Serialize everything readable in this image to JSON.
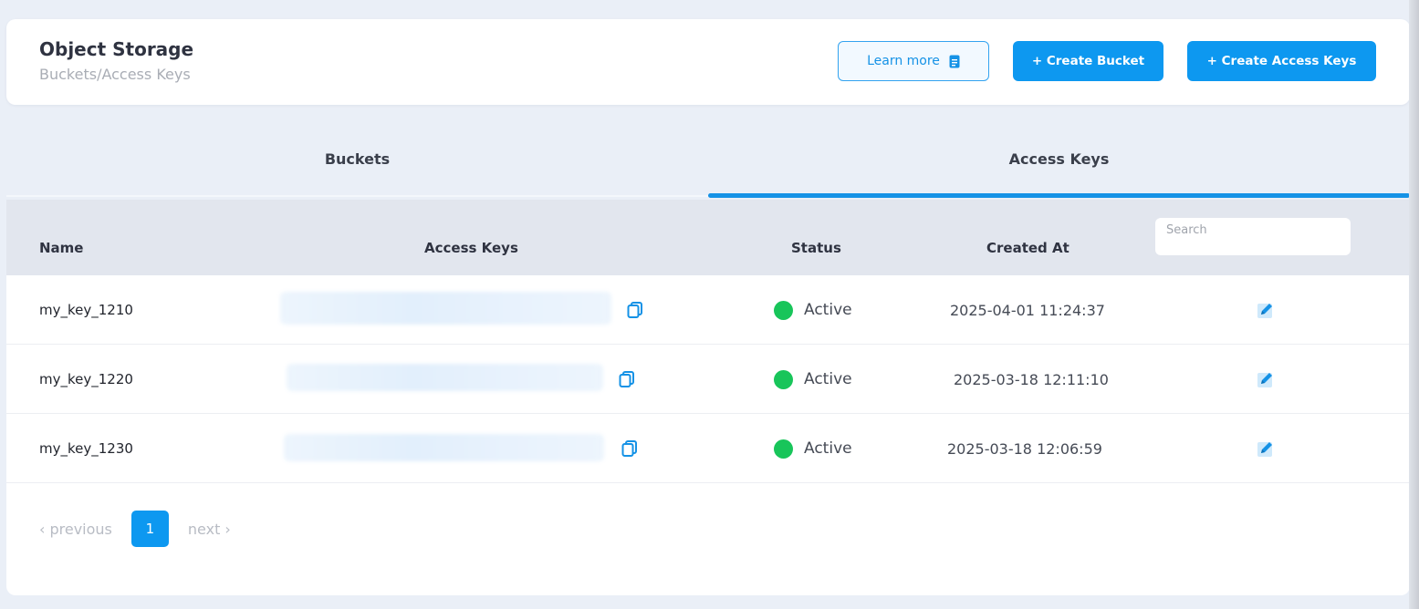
{
  "header": {
    "title": "Object Storage",
    "subtitle": "Buckets/Access Keys",
    "learn_more_label": "Learn more",
    "create_bucket_label": "+ Create Bucket",
    "create_access_keys_label": "+ Create Access Keys"
  },
  "tabs": [
    {
      "label": "Buckets",
      "active": false
    },
    {
      "label": "Access Keys",
      "active": true
    }
  ],
  "table": {
    "columns": {
      "name": "Name",
      "access_keys": "Access Keys",
      "status": "Status",
      "created_at": "Created At"
    },
    "search_placeholder": "Search",
    "rows": [
      {
        "name": "my_key_1210",
        "status": "Active",
        "created_at": "2025-04-01 11:24:37"
      },
      {
        "name": "my_key_1220",
        "status": "Active",
        "created_at": "2025-03-18 12:11:10"
      },
      {
        "name": "my_key_1230",
        "status": "Active",
        "created_at": "2025-03-18 12:06:59"
      }
    ]
  },
  "pagination": {
    "previous_label": "‹ previous",
    "current_page": "1",
    "next_label": "next ›"
  },
  "colors": {
    "accent": "#0d98f0",
    "status_active": "#18c55a",
    "background": "#eaeff7"
  },
  "icons": {
    "learn_more": "document-icon",
    "copy": "copy-icon",
    "edit": "edit-icon",
    "status": "status-dot-icon"
  }
}
